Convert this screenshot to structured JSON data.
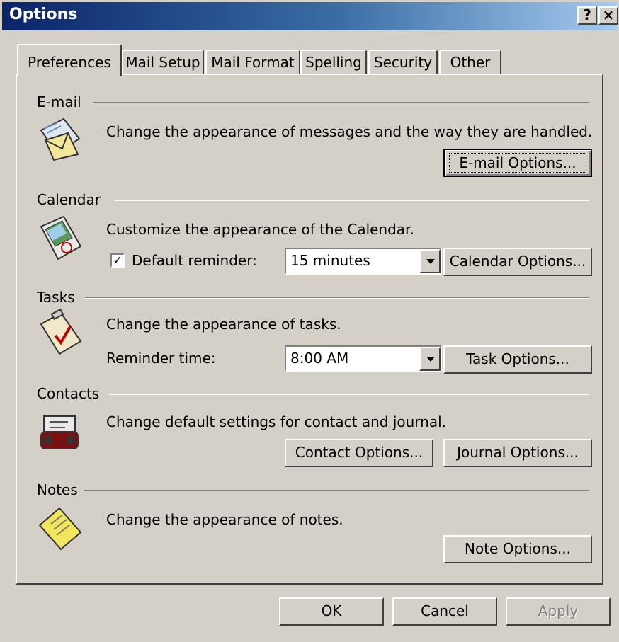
{
  "window": {
    "title": "Options",
    "help_label": "?",
    "close_label": "×"
  },
  "tabs": [
    "Preferences",
    "Mail Setup",
    "Mail Format",
    "Spelling",
    "Security",
    "Other"
  ],
  "sections": {
    "email": {
      "label": "E-mail",
      "description": "Change the appearance of messages and the way they are handled.",
      "button": "E-mail Options..."
    },
    "calendar": {
      "label": "Calendar",
      "description": "Customize the appearance of the Calendar.",
      "reminder_label": "Default reminder:",
      "reminder_checked": true,
      "reminder_value": "15 minutes",
      "button": "Calendar Options..."
    },
    "tasks": {
      "label": "Tasks",
      "description": "Change the appearance of tasks.",
      "reminder_label": "Reminder time:",
      "reminder_value": "8:00 AM",
      "button": "Task Options..."
    },
    "contacts": {
      "label": "Contacts",
      "description": "Change default settings for contact and journal.",
      "contact_button": "Contact Options...",
      "journal_button": "Journal Options..."
    },
    "notes": {
      "label": "Notes",
      "description": "Change the appearance of notes.",
      "button": "Note Options..."
    }
  },
  "footer": {
    "ok": "OK",
    "cancel": "Cancel",
    "apply": "Apply"
  },
  "icons": [
    "email-icon",
    "calendar-icon",
    "tasks-icon",
    "contacts-icon",
    "notes-icon",
    "checkmark-icon",
    "dropdown-arrow-icon"
  ]
}
